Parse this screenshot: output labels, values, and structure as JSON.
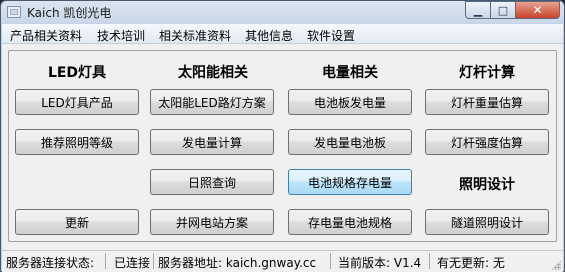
{
  "window": {
    "title": "Kaich 凯创光电"
  },
  "menu": [
    "产品相关资料",
    "技术培训",
    "相关标准资料",
    "其他信息",
    "软件设置"
  ],
  "headings": {
    "led": "LED灯具",
    "solar": "太阳能相关",
    "power": "电量相关",
    "pole": "灯杆计算",
    "lighting": "照明设计"
  },
  "buttons": {
    "led_products": "LED灯具产品",
    "recommend_level": "推荐照明等级",
    "update": "更新",
    "solar_street_light": "太阳能LED路灯方案",
    "power_calc": "发电量计算",
    "sunshine_query": "日照查询",
    "grid_station": "并网电站方案",
    "panel_power": "电池板发电量",
    "power_panel": "发电量电池板",
    "battery_spec_storage": "电池规格存电量",
    "storage_battery_spec": "存电量电池规格",
    "pole_weight": "灯杆重量估算",
    "pole_strength": "灯杆强度估算",
    "tunnel_lighting": "隧道照明设计"
  },
  "status": {
    "conn_label": "服务器连接状态:",
    "conn_value": "已连接",
    "addr": "服务器地址: kaich.gnway.cc",
    "version": "当前版本: V1.4",
    "update_status": "有无更新: 无"
  }
}
